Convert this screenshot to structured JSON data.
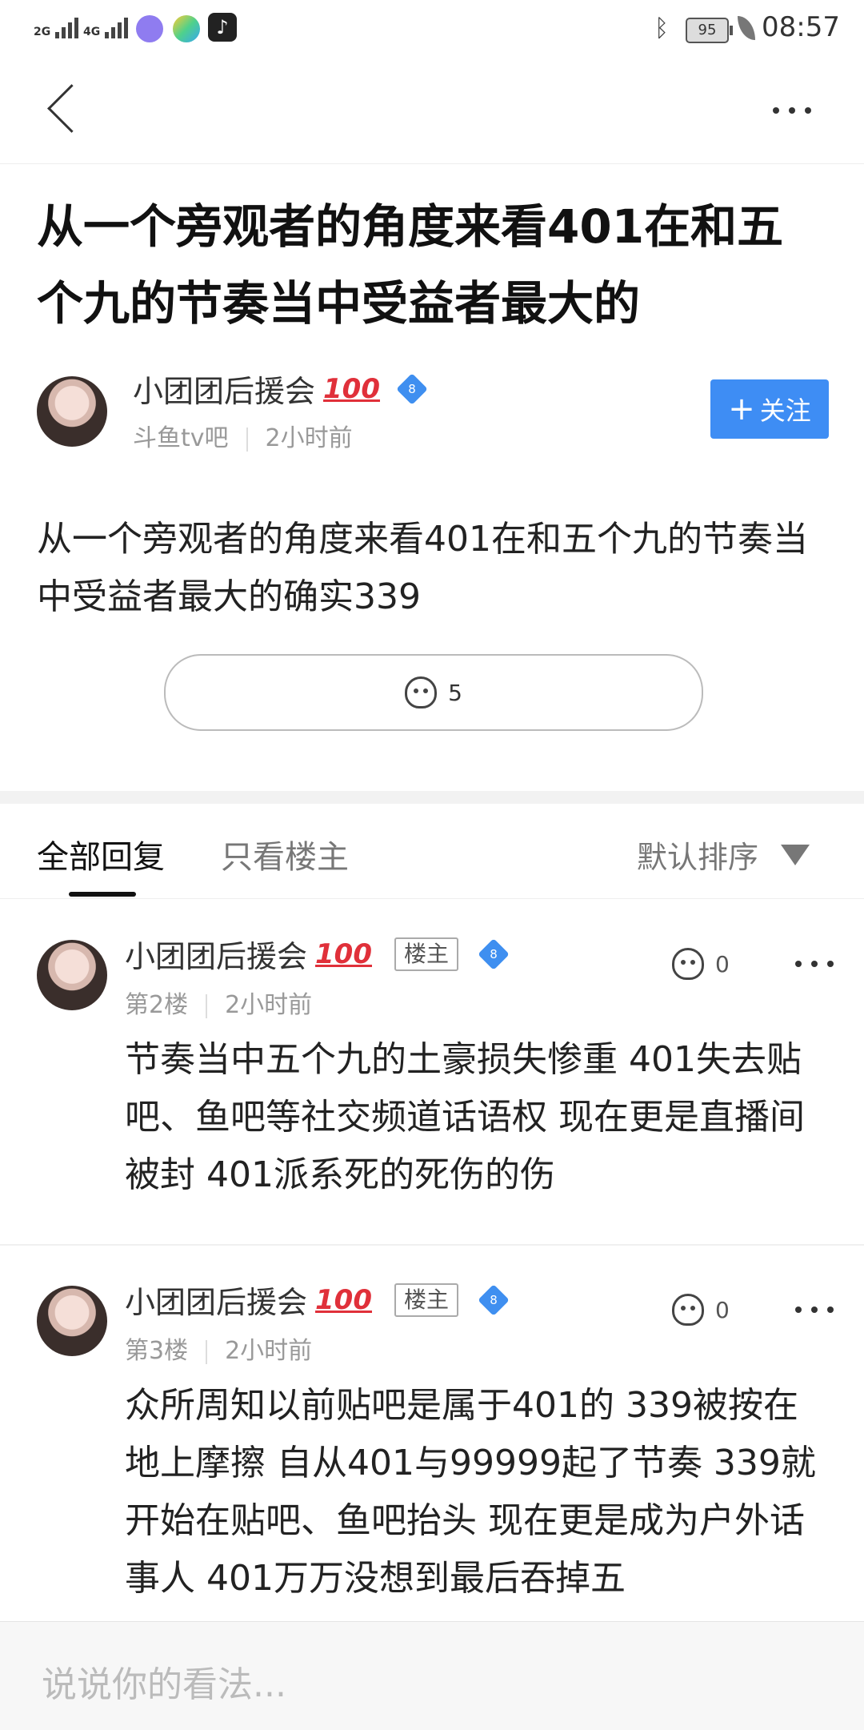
{
  "status_bar": {
    "network_1": "2G",
    "network_2": "4G",
    "battery": "95",
    "time": "08:57"
  },
  "post": {
    "title": "从一个旁观者的角度来看401在和五个九的节奏当中受益者最大的",
    "author": "小团团后援会",
    "author_emoji": "100",
    "level": "8",
    "forum": "斗鱼tv吧",
    "time": "2小时前",
    "follow_label": "关注",
    "content": "从一个旁观者的角度来看401在和五个九的节奏当中受益者最大的确实339",
    "like_count": "5"
  },
  "tabs": {
    "all_replies": "全部回复",
    "only_op": "只看楼主",
    "sort_label": "默认排序"
  },
  "replies": [
    {
      "author": "小团团后援会",
      "badge": "楼主",
      "level": "8",
      "floor": "第2楼",
      "time": "2小时前",
      "likes": "0",
      "text": "节奏当中五个九的土豪损失惨重 401失去贴吧、鱼吧等社交频道话语权 现在更是直播间被封 401派系死的死伤的伤"
    },
    {
      "author": "小团团后援会",
      "badge": "楼主",
      "level": "8",
      "floor": "第3楼",
      "time": "2小时前",
      "likes": "0",
      "text": "众所周知以前贴吧是属于401的 339被按在地上摩擦 自从401与99999起了节奏 339就开始在贴吧、鱼吧抬头 现在更是成为户外话事人 401万万没想到最后吞掉五"
    }
  ],
  "comment_input": {
    "placeholder": "说说你的看法..."
  },
  "colors": {
    "accent": "#3e8df4",
    "emoji_red": "#e0303a"
  }
}
